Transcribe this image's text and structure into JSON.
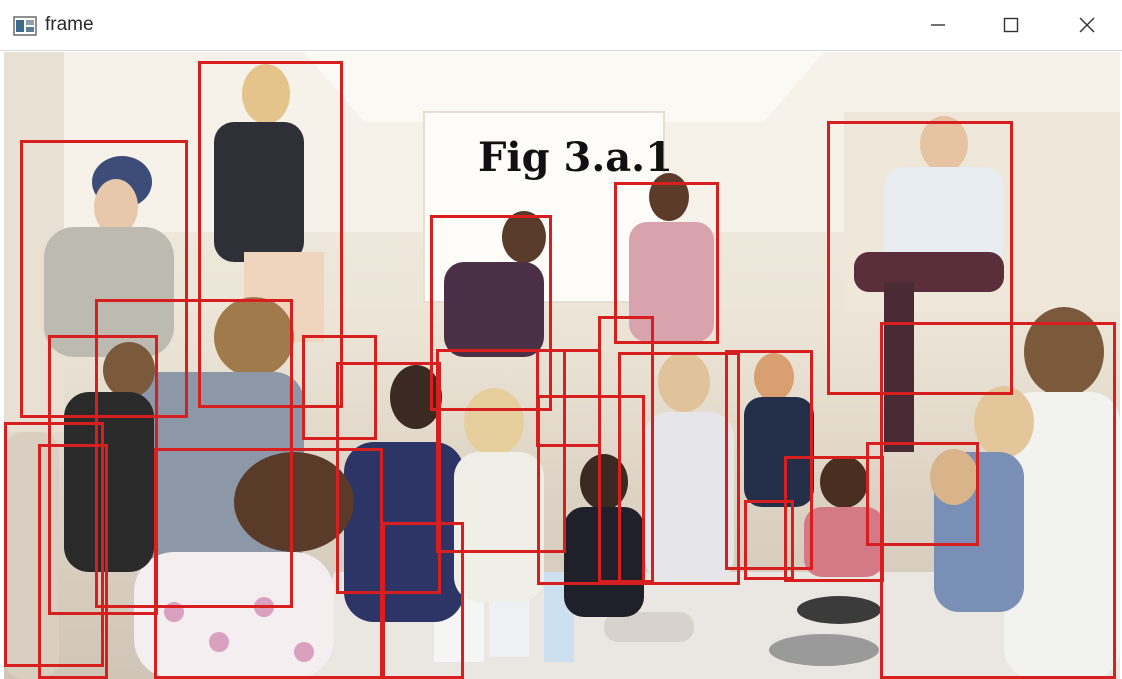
{
  "window": {
    "title": "frame",
    "icon": "opencv-frame-window-icon",
    "controls": [
      "minimize-icon",
      "maximize-icon",
      "close-icon"
    ]
  },
  "frame": {
    "caption": "Fig 3.a.1",
    "box_color": "#d81f1f",
    "detection_count": 28
  }
}
